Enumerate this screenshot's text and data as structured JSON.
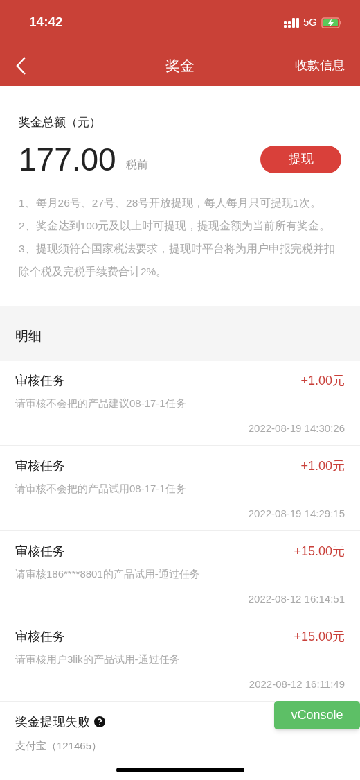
{
  "status_bar": {
    "time": "14:42",
    "network": "5G"
  },
  "nav": {
    "title": "奖金",
    "action": "收款信息"
  },
  "summary": {
    "label": "奖金总额（元）",
    "amount": "177.00",
    "note": "税前",
    "button": "提现",
    "rules": [
      "1、每月26号、27号、28号开放提现，每人每月只可提现1次。",
      "2、奖金达到100元及以上时可提现，提现金额为当前所有奖金。",
      "3、提现须符合国家税法要求，提现时平台将为用户申报完税并扣除个税及完税手续费合计2%。"
    ]
  },
  "details": {
    "title": "明细",
    "items": [
      {
        "kind": "income",
        "title": "审核任务",
        "amount": "+1.00元",
        "description": "请审核不会把的产品建议08-17-1任务",
        "time": "2022-08-19 14:30:26"
      },
      {
        "kind": "income",
        "title": "审核任务",
        "amount": "+1.00元",
        "description": "请审核不会把的产品试用08-17-1任务",
        "time": "2022-08-19 14:29:15"
      },
      {
        "kind": "income",
        "title": "审核任务",
        "amount": "+15.00元",
        "description": "请审核186****8801的产品试用-通过任务",
        "time": "2022-08-12 16:14:51"
      },
      {
        "kind": "income",
        "title": "审核任务",
        "amount": "+15.00元",
        "description": "请审核用户3lik的产品试用-通过任务",
        "time": "2022-08-12 16:11:49"
      },
      {
        "kind": "failed",
        "title": "奖金提现失败",
        "description": "支付宝（121465）"
      }
    ]
  },
  "debug_button": "vConsole"
}
